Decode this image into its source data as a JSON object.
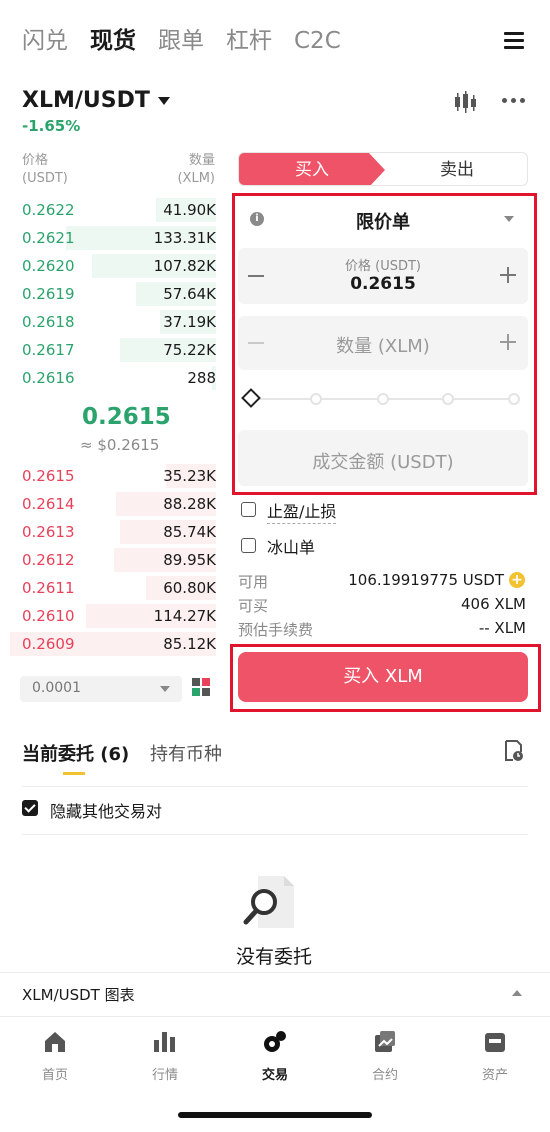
{
  "top_nav": {
    "tabs": [
      {
        "label": "闪兑",
        "active": false
      },
      {
        "label": "现货",
        "active": true
      },
      {
        "label": "跟单",
        "active": false
      },
      {
        "label": "杠杆",
        "active": false
      },
      {
        "label": "C2C",
        "active": false
      }
    ],
    "menu_icon": "hamburger-icon"
  },
  "pair": {
    "symbol": "XLM/USDT",
    "change": "-1.65%",
    "change_color": "#2ba36c"
  },
  "order_book": {
    "price_header": "价格",
    "price_unit": "(USDT)",
    "qty_header": "数量",
    "qty_unit": "(XLM)",
    "asks": [
      {
        "price": "0.2622",
        "qty": "41.90K"
      },
      {
        "price": "0.2621",
        "qty": "133.31K"
      },
      {
        "price": "0.2620",
        "qty": "107.82K"
      },
      {
        "price": "0.2619",
        "qty": "57.64K"
      },
      {
        "price": "0.2618",
        "qty": "37.19K"
      },
      {
        "price": "0.2617",
        "qty": "75.22K"
      },
      {
        "price": "0.2616",
        "qty": "288"
      }
    ],
    "last_price": "0.2615",
    "last_price_usd": "≈ $0.2615",
    "bids": [
      {
        "price": "0.2615",
        "qty": "35.23K"
      },
      {
        "price": "0.2614",
        "qty": "88.28K"
      },
      {
        "price": "0.2613",
        "qty": "85.74K"
      },
      {
        "price": "0.2612",
        "qty": "89.95K"
      },
      {
        "price": "0.2611",
        "qty": "60.80K"
      },
      {
        "price": "0.2610",
        "qty": "114.27K"
      },
      {
        "price": "0.2609",
        "qty": "85.12K"
      }
    ],
    "precision": "0.0001"
  },
  "trade": {
    "buy_label": "买入",
    "sell_label": "卖出",
    "order_type": "限价单",
    "price_label": "价格 (USDT)",
    "price_value": "0.2615",
    "qty_placeholder": "数量 (XLM)",
    "total_placeholder": "成交金额 (USDT)",
    "tp_sl_label": "止盈/止损",
    "iceberg_label": "冰山单",
    "available_label": "可用",
    "available_value": "106.19919775 USDT",
    "can_buy_label": "可买",
    "can_buy_value": "406 XLM",
    "fee_label": "预估手续费",
    "fee_value": "-- XLM",
    "submit_label": "买入 XLM"
  },
  "orders": {
    "tab_current": "当前委托 (6)",
    "tab_holdings": "持有币种",
    "hide_other_pairs": "隐藏其他交易对",
    "empty_text": "没有委托",
    "chart_toggle": "XLM/USDT 图表"
  },
  "bottom_nav": [
    {
      "label": "首页",
      "icon": "home-icon",
      "active": false
    },
    {
      "label": "行情",
      "icon": "market-icon",
      "active": false
    },
    {
      "label": "交易",
      "icon": "trade-icon",
      "active": true
    },
    {
      "label": "合约",
      "icon": "contract-icon",
      "active": false
    },
    {
      "label": "资产",
      "icon": "assets-icon",
      "active": false
    }
  ],
  "colors": {
    "buy": "#ef5368",
    "up": "#2ba36c",
    "down": "#e8415a",
    "highlight": "#e0142c"
  }
}
